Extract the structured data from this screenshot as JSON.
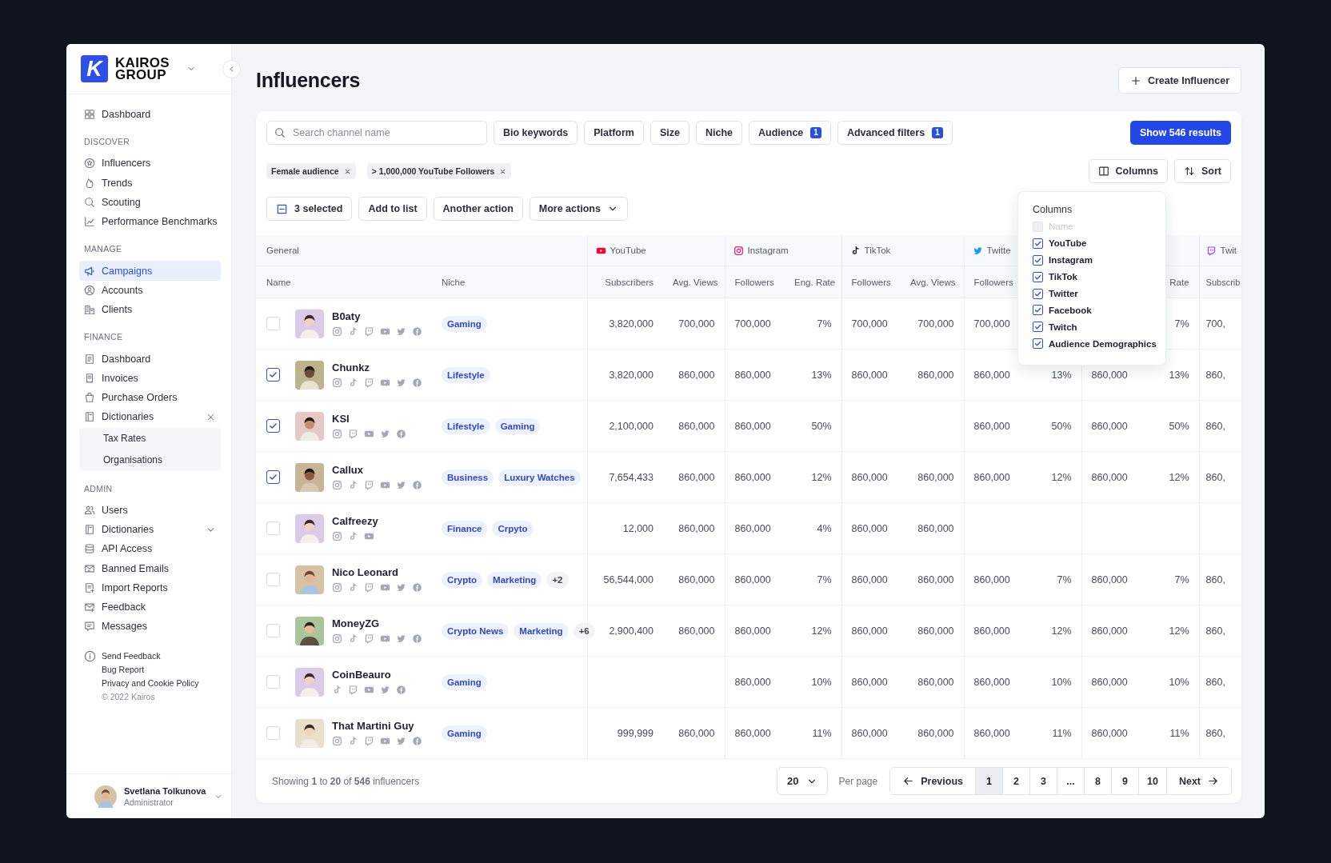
{
  "brand": {
    "mark": "K",
    "name": "KAIROS GROUP"
  },
  "sidebar": {
    "top": [
      {
        "label": "Dashboard",
        "selected": false
      }
    ],
    "sections": [
      {
        "title": "DISCOVER",
        "items": [
          {
            "label": "Influencers",
            "selected": false
          },
          {
            "label": "Trends",
            "selected": false
          },
          {
            "label": "Scouting",
            "selected": false
          },
          {
            "label": "Performance Benchmarks",
            "selected": false
          }
        ]
      },
      {
        "title": "MANAGE",
        "items": [
          {
            "label": "Campaigns",
            "selected": true
          },
          {
            "label": "Accounts",
            "selected": false
          },
          {
            "label": "Clients",
            "selected": false
          }
        ]
      },
      {
        "title": "FINANCE",
        "items": [
          {
            "label": "Dashboard",
            "selected": false
          },
          {
            "label": "Invoices",
            "selected": false
          },
          {
            "label": "Purchase Orders",
            "selected": false
          },
          {
            "label": "Dictionaries",
            "selected": false,
            "expanded": true,
            "children": [
              {
                "label": "Tax Rates",
                "selected": false
              },
              {
                "label": "Organisations",
                "selected": false
              }
            ]
          }
        ]
      },
      {
        "title": "ADMIN",
        "items": [
          {
            "label": "Users",
            "selected": false
          },
          {
            "label": "Dictionaries",
            "selected": false,
            "expanded": false
          },
          {
            "label": "API Access",
            "selected": false
          },
          {
            "label": "Banned Emails",
            "selected": false
          },
          {
            "label": "Import Reports",
            "selected": false
          },
          {
            "label": "Feedback",
            "selected": false
          },
          {
            "label": "Messages",
            "selected": false
          }
        ]
      }
    ],
    "links": [
      "Send Feedback",
      "Bug Report",
      "Privacy and Cookie Policy",
      "© 2022 Kairos"
    ],
    "user": {
      "name": "Svetlana Tolkunova",
      "role": "Administrator"
    }
  },
  "page": {
    "title": "Influencers",
    "create_button": "Create Influencer"
  },
  "filters": {
    "search": {
      "placeholder": "Search channel name"
    },
    "buttons": [
      {
        "label": "Bio keywords"
      },
      {
        "label": "Platform"
      },
      {
        "label": "Size"
      },
      {
        "label": "Niche"
      },
      {
        "label": "Audience",
        "badge": "1"
      },
      {
        "label": "Advanced filters",
        "badge": "1"
      }
    ],
    "submit": "Show 546 results",
    "chips": [
      "Female audience",
      "> 1,000,000 YouTube Followers"
    ],
    "columns_button": "Columns",
    "sort_button": "Sort"
  },
  "bulk": {
    "selected_label": "3 selected",
    "actions": [
      "Add to list",
      "Another action"
    ],
    "more": "More actions"
  },
  "columns_menu": {
    "title": "Columns",
    "items": [
      {
        "label": "Name",
        "checked": false,
        "disabled": true
      },
      {
        "label": "YouTube",
        "checked": true,
        "disabled": false
      },
      {
        "label": "Instagram",
        "checked": true,
        "disabled": false
      },
      {
        "label": "TikTok",
        "checked": true,
        "disabled": false
      },
      {
        "label": "Twitter",
        "checked": true,
        "disabled": false
      },
      {
        "label": "Facebook",
        "checked": true,
        "disabled": false
      },
      {
        "label": "Twitch",
        "checked": true,
        "disabled": false
      },
      {
        "label": "Audience Demographics",
        "checked": true,
        "disabled": false
      }
    ]
  },
  "table": {
    "groups": [
      {
        "label": "General"
      },
      {
        "label": "YouTube",
        "kind": "youtube"
      },
      {
        "label": "Instagram",
        "kind": "instagram"
      },
      {
        "label": "TikTok",
        "kind": "tiktok"
      },
      {
        "label": "Twitte",
        "kind": "twitter"
      },
      {
        "label": "Twit",
        "kind": "twitch"
      }
    ],
    "name_column": "Name",
    "niche_column": "Niche",
    "columns": [
      "Subscribers",
      "Avg. Views",
      "Followers",
      "Eng. Rate",
      "Followers",
      "Avg. Views",
      "Followers",
      "",
      "",
      "Rate",
      "Subscrib"
    ],
    "rows": [
      {
        "name": "B0aty",
        "checked": false,
        "platforms": [
          {
            "kind": "instagram"
          },
          {
            "kind": "tiktok"
          },
          {
            "kind": "twitch"
          },
          {
            "kind": "youtube"
          },
          {
            "kind": "twitter"
          },
          {
            "kind": "facebook"
          }
        ],
        "niches": [
          {
            "label": "Gaming",
            "kind": "tag"
          }
        ],
        "cells": [
          "3,820,000",
          "700,000",
          "700,000",
          "7%",
          "700,000",
          "700,000",
          "700,000",
          null,
          null,
          "7%",
          "700,"
        ]
      },
      {
        "name": "Chunkz",
        "checked": true,
        "platforms": [
          {
            "kind": "instagram"
          },
          {
            "kind": "tiktok"
          },
          {
            "kind": "twitch"
          },
          {
            "kind": "youtube"
          },
          {
            "kind": "twitter"
          },
          {
            "kind": "facebook"
          }
        ],
        "niches": [
          {
            "label": "Lifestyle",
            "kind": "tag"
          }
        ],
        "cells": [
          "3,820,000",
          "860,000",
          "860,000",
          "13%",
          "860,000",
          "860,000",
          "860,000",
          "13%",
          "860,000",
          "13%",
          "860,"
        ]
      },
      {
        "name": "KSI",
        "checked": true,
        "platforms": [
          {
            "kind": "instagram"
          },
          {
            "kind": "twitch"
          },
          {
            "kind": "youtube"
          },
          {
            "kind": "twitter"
          },
          {
            "kind": "facebook"
          }
        ],
        "niches": [
          {
            "label": "Lifestyle",
            "kind": "tag"
          },
          {
            "label": "Gaming",
            "kind": "tag"
          }
        ],
        "cells": [
          "2,100,000",
          "860,000",
          "860,000",
          "50%",
          null,
          null,
          "860,000",
          "50%",
          "860,000",
          "50%",
          "860,"
        ]
      },
      {
        "name": "Callux",
        "checked": true,
        "platforms": [
          {
            "kind": "instagram"
          },
          {
            "kind": "tiktok"
          },
          {
            "kind": "twitch"
          },
          {
            "kind": "youtube"
          },
          {
            "kind": "twitter"
          },
          {
            "kind": "facebook"
          }
        ],
        "niches": [
          {
            "label": "Business",
            "kind": "tag"
          },
          {
            "label": "Luxury Watches",
            "kind": "tag"
          }
        ],
        "cells": [
          "7,654,433",
          "860,000",
          "860,000",
          "12%",
          "860,000",
          "860,000",
          "860,000",
          "12%",
          "860,000",
          "12%",
          "860,"
        ]
      },
      {
        "name": "Calfreezy",
        "checked": false,
        "platforms": [
          {
            "kind": "instagram"
          },
          {
            "kind": "tiktok"
          },
          {
            "kind": "youtube"
          }
        ],
        "niches": [
          {
            "label": "Finance",
            "kind": "tag"
          },
          {
            "label": "Crpyto",
            "kind": "tag"
          }
        ],
        "cells": [
          "12,000",
          "860,000",
          "860,000",
          "4%",
          "860,000",
          "860,000",
          null,
          null,
          null,
          null,
          null
        ]
      },
      {
        "name": "Nico Leonard",
        "checked": false,
        "platforms": [
          {
            "kind": "instagram"
          },
          {
            "kind": "tiktok"
          },
          {
            "kind": "twitch"
          },
          {
            "kind": "youtube"
          },
          {
            "kind": "twitter"
          },
          {
            "kind": "facebook"
          }
        ],
        "niches": [
          {
            "label": "Crypto",
            "kind": "tag"
          },
          {
            "label": "Marketing",
            "kind": "tag"
          },
          {
            "label": "+2",
            "kind": "more"
          }
        ],
        "cells": [
          "56,544,000",
          "860,000",
          "860,000",
          "7%",
          "860,000",
          "860,000",
          "860,000",
          "7%",
          "860,000",
          "7%",
          "860,"
        ]
      },
      {
        "name": "MoneyZG",
        "checked": false,
        "platforms": [
          {
            "kind": "instagram"
          },
          {
            "kind": "tiktok"
          },
          {
            "kind": "twitch"
          },
          {
            "kind": "youtube"
          },
          {
            "kind": "twitter"
          },
          {
            "kind": "facebook"
          }
        ],
        "niches": [
          {
            "label": "Crypto News",
            "kind": "tag"
          },
          {
            "label": "Marketing",
            "kind": "tag"
          },
          {
            "label": "+6",
            "kind": "more"
          }
        ],
        "cells": [
          "2,900,400",
          "860,000",
          "860,000",
          "12%",
          "860,000",
          "860,000",
          "860,000",
          "12%",
          "860,000",
          "12%",
          "860,"
        ]
      },
      {
        "name": "CoinBeauro",
        "checked": false,
        "platforms": [
          {
            "kind": "tiktok"
          },
          {
            "kind": "twitch"
          },
          {
            "kind": "youtube"
          },
          {
            "kind": "twitter"
          },
          {
            "kind": "facebook"
          }
        ],
        "niches": [
          {
            "label": "Gaming",
            "kind": "tag"
          }
        ],
        "cells": [
          null,
          null,
          "860,000",
          "10%",
          "860,000",
          "860,000",
          "860,000",
          "10%",
          "860,000",
          "10%",
          "860,"
        ]
      },
      {
        "name": "That Martini Guy",
        "checked": false,
        "platforms": [
          {
            "kind": "instagram"
          },
          {
            "kind": "tiktok"
          },
          {
            "kind": "twitch"
          },
          {
            "kind": "youtube"
          },
          {
            "kind": "twitter"
          },
          {
            "kind": "facebook"
          }
        ],
        "niches": [
          {
            "label": "Gaming",
            "kind": "tag"
          }
        ],
        "cells": [
          "999,999",
          "860,000",
          "860,000",
          "11%",
          "860,000",
          "860,000",
          "860,000",
          "11%",
          "860,000",
          "11%",
          "860,"
        ]
      }
    ]
  },
  "footer": {
    "summary": "Showing **1** to **20** of **546** influencers",
    "per_page_value": "20",
    "per_page_label": "Per page",
    "prev": "Previous",
    "next": "Next",
    "pages": [
      {
        "label": "1",
        "selected": true
      },
      {
        "label": "2",
        "selected": false
      },
      {
        "label": "3",
        "selected": false
      },
      {
        "label": "...",
        "selected": false
      },
      {
        "label": "8",
        "selected": false
      },
      {
        "label": "9",
        "selected": false
      },
      {
        "label": "10",
        "selected": false
      }
    ]
  }
}
